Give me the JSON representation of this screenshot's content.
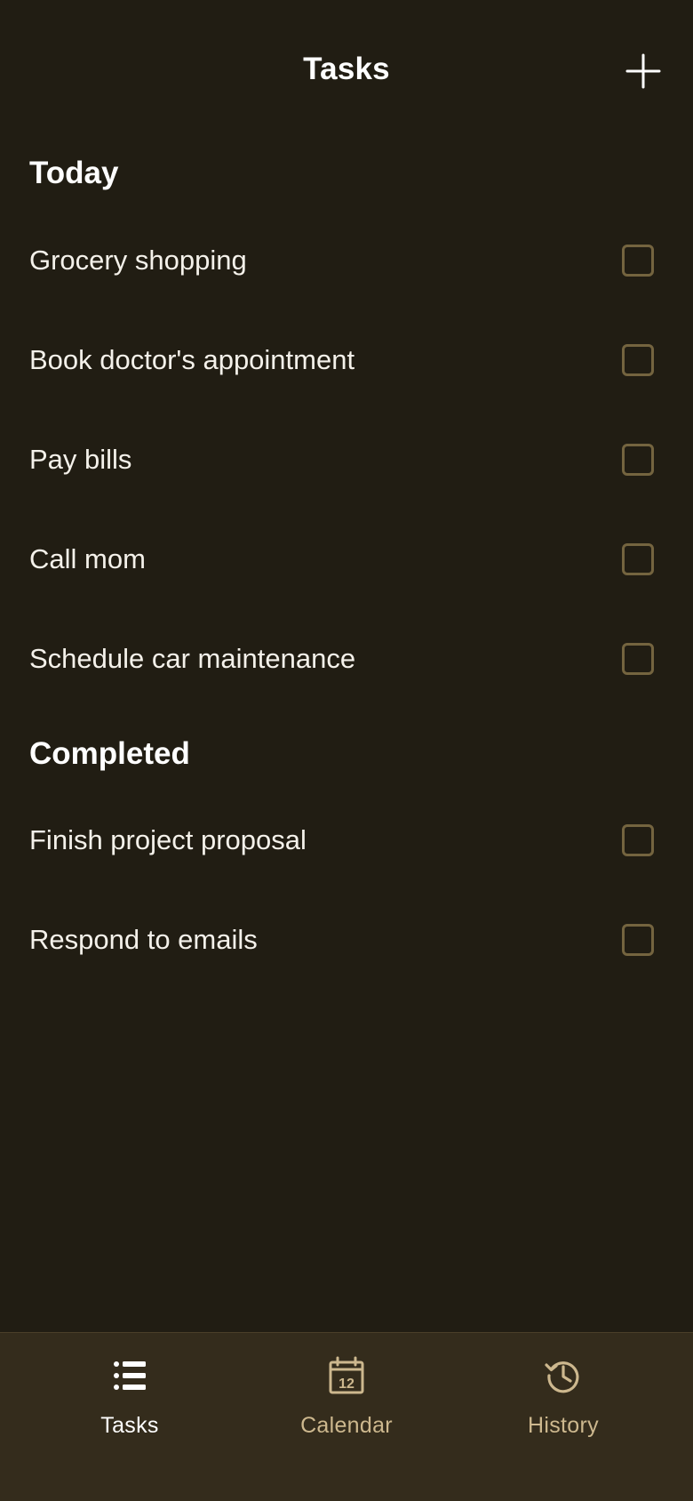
{
  "header": {
    "title": "Tasks",
    "add_icon": "plus-icon"
  },
  "sections": {
    "today": {
      "heading": "Today",
      "tasks": [
        {
          "label": "Grocery shopping",
          "checked": false
        },
        {
          "label": "Book doctor's appointment",
          "checked": false
        },
        {
          "label": "Pay bills",
          "checked": false
        },
        {
          "label": "Call mom",
          "checked": false
        },
        {
          "label": "Schedule car maintenance",
          "checked": false
        }
      ]
    },
    "completed": {
      "heading": "Completed",
      "tasks": [
        {
          "label": "Finish project proposal",
          "checked": false
        },
        {
          "label": "Respond to emails",
          "checked": false
        }
      ]
    }
  },
  "tabbar": {
    "tabs": [
      {
        "label": "Tasks",
        "icon": "list-icon",
        "active": true
      },
      {
        "label": "Calendar",
        "icon": "calendar-icon",
        "active": false,
        "icon_text": "12"
      },
      {
        "label": "History",
        "icon": "history-icon",
        "active": false
      }
    ]
  },
  "colors": {
    "background": "#211d13",
    "tabbar_background": "#342c1c",
    "checkbox_border": "#74643f",
    "inactive_tab": "#cdb88e",
    "text": "#ffffff"
  }
}
